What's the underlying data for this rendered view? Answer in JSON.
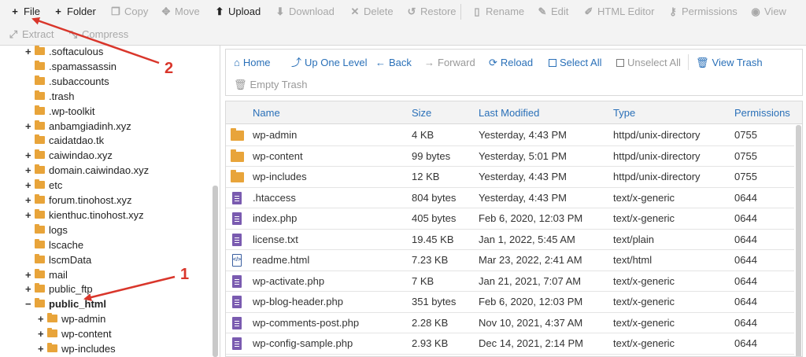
{
  "toolbar": {
    "row1": [
      {
        "key": "file",
        "icon": "plus-icon",
        "glyph": "+",
        "label": "File",
        "enabled": true
      },
      {
        "key": "folder",
        "icon": "plus-icon",
        "glyph": "+",
        "label": "Folder",
        "enabled": true
      },
      {
        "key": "copy",
        "icon": "copy-icon",
        "glyph": "❐",
        "label": "Copy",
        "enabled": false
      },
      {
        "key": "move",
        "icon": "move-icon",
        "glyph": "✥",
        "label": "Move",
        "enabled": false
      },
      {
        "key": "upload",
        "icon": "upload-icon",
        "glyph": "⬆",
        "label": "Upload",
        "enabled": true
      },
      {
        "key": "download",
        "icon": "download-icon",
        "glyph": "⬇",
        "label": "Download",
        "enabled": false
      },
      {
        "key": "delete",
        "icon": "delete-icon",
        "glyph": "✕",
        "label": "Delete",
        "enabled": false
      },
      {
        "key": "restore",
        "icon": "restore-icon",
        "glyph": "↺",
        "label": "Restore",
        "enabled": false
      },
      {
        "key": "rename",
        "icon": "rename-icon",
        "glyph": "▯",
        "label": "Rename",
        "enabled": false
      },
      {
        "key": "edit",
        "icon": "pencil-icon",
        "glyph": "✎",
        "label": "Edit",
        "enabled": false
      },
      {
        "key": "html_editor",
        "icon": "html-editor-icon",
        "glyph": "✐",
        "label": "HTML Editor",
        "enabled": false
      },
      {
        "key": "permissions",
        "icon": "key-icon",
        "glyph": "⚷",
        "label": "Permissions",
        "enabled": false
      },
      {
        "key": "view",
        "icon": "eye-icon",
        "glyph": "◉",
        "label": "View",
        "enabled": false
      }
    ],
    "row2": [
      {
        "key": "extract",
        "icon": "extract-icon",
        "glyph": "⤢",
        "label": "Extract",
        "enabled": false
      },
      {
        "key": "compress",
        "icon": "compress-icon",
        "glyph": "⤡",
        "label": "Compress",
        "enabled": false
      }
    ]
  },
  "tree": [
    {
      "label": ".softaculous",
      "expandable": true,
      "depth": 0
    },
    {
      "label": ".spamassassin",
      "expandable": false,
      "depth": 0
    },
    {
      "label": ".subaccounts",
      "expandable": false,
      "depth": 0
    },
    {
      "label": ".trash",
      "expandable": false,
      "depth": 0
    },
    {
      "label": ".wp-toolkit",
      "expandable": false,
      "depth": 0
    },
    {
      "label": "anbamgiadinh.xyz",
      "expandable": true,
      "depth": 0
    },
    {
      "label": "caidatdao.tk",
      "expandable": false,
      "depth": 0
    },
    {
      "label": "caiwindao.xyz",
      "expandable": true,
      "depth": 0
    },
    {
      "label": "domain.caiwindao.xyz",
      "expandable": true,
      "depth": 0
    },
    {
      "label": "etc",
      "expandable": true,
      "depth": 0
    },
    {
      "label": "forum.tinohost.xyz",
      "expandable": true,
      "depth": 0
    },
    {
      "label": "kienthuc.tinohost.xyz",
      "expandable": true,
      "depth": 0
    },
    {
      "label": "logs",
      "expandable": false,
      "depth": 0
    },
    {
      "label": "lscache",
      "expandable": false,
      "depth": 0
    },
    {
      "label": "lscmData",
      "expandable": false,
      "depth": 0
    },
    {
      "label": "mail",
      "expandable": true,
      "depth": 0
    },
    {
      "label": "public_ftp",
      "expandable": true,
      "depth": 0
    },
    {
      "label": "public_html",
      "expandable": true,
      "expanded": true,
      "active": true,
      "depth": 0
    },
    {
      "label": "wp-admin",
      "expandable": true,
      "depth": 1
    },
    {
      "label": "wp-content",
      "expandable": true,
      "depth": 1
    },
    {
      "label": "wp-includes",
      "expandable": true,
      "depth": 1
    }
  ],
  "nav": {
    "home": {
      "icon": "home-icon",
      "glyph": "⌂",
      "label": "Home"
    },
    "up": {
      "icon": "level-up-icon",
      "glyph": "⤴",
      "label": "Up One Level"
    },
    "back": {
      "icon": "arrow-left-icon",
      "glyph": "←",
      "label": "Back"
    },
    "forward": {
      "icon": "arrow-right-icon",
      "glyph": "→",
      "label": "Forward"
    },
    "reload": {
      "icon": "reload-icon",
      "glyph": "⟳",
      "label": "Reload"
    },
    "select_all": {
      "icon": "checkbox-checked-icon",
      "label": "Select All"
    },
    "unselect_all": {
      "icon": "checkbox-icon",
      "label": "Unselect All"
    },
    "view_trash": {
      "icon": "trash-icon",
      "glyph": "🗑",
      "label": "View Trash"
    },
    "empty_trash": {
      "icon": "trash-icon",
      "glyph": "🗑",
      "label": "Empty Trash"
    }
  },
  "table": {
    "headers": {
      "name": "Name",
      "size": "Size",
      "modified": "Last Modified",
      "type": "Type",
      "perms": "Permissions"
    },
    "rows": [
      {
        "icon": "folder-icon",
        "name": "wp-admin",
        "size": "4 KB",
        "modified": "Yesterday, 4:43 PM",
        "type": "httpd/unix-directory",
        "perms": "0755"
      },
      {
        "icon": "folder-icon",
        "name": "wp-content",
        "size": "99 bytes",
        "modified": "Yesterday, 5:01 PM",
        "type": "httpd/unix-directory",
        "perms": "0755"
      },
      {
        "icon": "folder-icon",
        "name": "wp-includes",
        "size": "12 KB",
        "modified": "Yesterday, 4:43 PM",
        "type": "httpd/unix-directory",
        "perms": "0755"
      },
      {
        "icon": "file-icon",
        "name": ".htaccess",
        "size": "804 bytes",
        "modified": "Yesterday, 4:43 PM",
        "type": "text/x-generic",
        "perms": "0644"
      },
      {
        "icon": "file-icon",
        "name": "index.php",
        "size": "405 bytes",
        "modified": "Feb 6, 2020, 12:03 PM",
        "type": "text/x-generic",
        "perms": "0644"
      },
      {
        "icon": "file-icon",
        "name": "license.txt",
        "size": "19.45 KB",
        "modified": "Jan 1, 2022, 5:45 AM",
        "type": "text/plain",
        "perms": "0644"
      },
      {
        "icon": "html-file-icon",
        "name": "readme.html",
        "size": "7.23 KB",
        "modified": "Mar 23, 2022, 2:41 AM",
        "type": "text/html",
        "perms": "0644"
      },
      {
        "icon": "file-icon",
        "name": "wp-activate.php",
        "size": "7 KB",
        "modified": "Jan 21, 2021, 7:07 AM",
        "type": "text/x-generic",
        "perms": "0644"
      },
      {
        "icon": "file-icon",
        "name": "wp-blog-header.php",
        "size": "351 bytes",
        "modified": "Feb 6, 2020, 12:03 PM",
        "type": "text/x-generic",
        "perms": "0644"
      },
      {
        "icon": "file-icon",
        "name": "wp-comments-post.php",
        "size": "2.28 KB",
        "modified": "Nov 10, 2021, 4:37 AM",
        "type": "text/x-generic",
        "perms": "0644"
      },
      {
        "icon": "file-icon",
        "name": "wp-config-sample.php",
        "size": "2.93 KB",
        "modified": "Dec 14, 2021, 2:14 PM",
        "type": "text/x-generic",
        "perms": "0644"
      }
    ]
  },
  "annotations": {
    "one": "1",
    "two": "2",
    "color": "#d9362b"
  }
}
